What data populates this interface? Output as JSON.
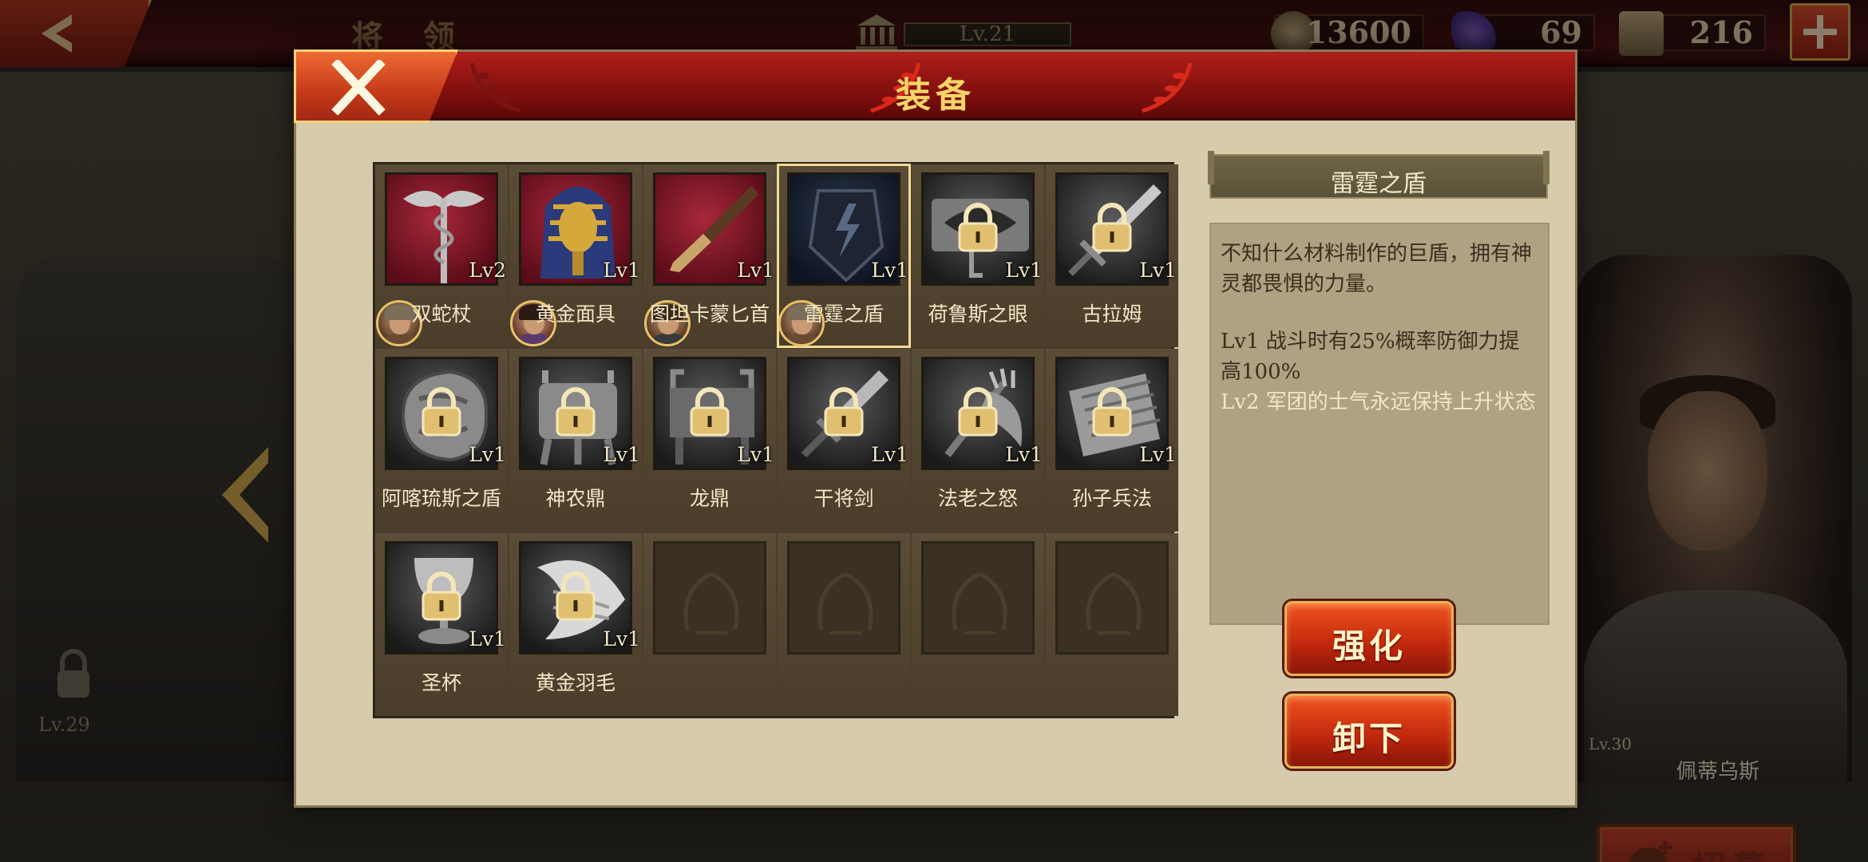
{
  "topbar": {
    "screen_title": "将 领",
    "hall_level": "Lv.21",
    "resources": [
      {
        "icon": "coin-icon",
        "value": "13600"
      },
      {
        "icon": "gem-icon",
        "value": "69"
      },
      {
        "icon": "banner-icon",
        "value": "216"
      }
    ]
  },
  "background": {
    "locked_slot_level": "Lv.29",
    "hero_name": "佩蒂乌斯",
    "hero_level": "Lv.30",
    "recruit_label": "招募"
  },
  "modal": {
    "title": "装备",
    "items": [
      {
        "name": "双蛇杖",
        "level": "Lv2",
        "owned": true,
        "locked": false,
        "art": "caduceus"
      },
      {
        "name": "黄金面具",
        "level": "Lv1",
        "owned": true,
        "locked": false,
        "art": "golden-mask"
      },
      {
        "name": "图坦卡蒙匕首",
        "level": "Lv1",
        "owned": true,
        "locked": false,
        "art": "dagger"
      },
      {
        "name": "雷霆之盾",
        "level": "Lv1",
        "owned": true,
        "locked": false,
        "art": "thunder-shield",
        "selected": true
      },
      {
        "name": "荷鲁斯之眼",
        "level": "Lv1",
        "owned": false,
        "locked": true,
        "art": "eye-of-horus"
      },
      {
        "name": "古拉姆",
        "level": "Lv1",
        "owned": false,
        "locked": true,
        "art": "sword"
      },
      {
        "name": "阿喀琉斯之盾",
        "level": "Lv1",
        "owned": false,
        "locked": true,
        "art": "round-shield"
      },
      {
        "name": "神农鼎",
        "level": "Lv1",
        "owned": false,
        "locked": true,
        "art": "cauldron"
      },
      {
        "name": "龙鼎",
        "level": "Lv1",
        "owned": false,
        "locked": true,
        "art": "dragon-cauldron"
      },
      {
        "name": "干将剑",
        "level": "Lv1",
        "owned": false,
        "locked": true,
        "art": "short-sword"
      },
      {
        "name": "法老之怒",
        "level": "Lv1",
        "owned": false,
        "locked": true,
        "art": "axe"
      },
      {
        "name": "孙子兵法",
        "level": "Lv1",
        "owned": false,
        "locked": true,
        "art": "scroll"
      },
      {
        "name": "圣杯",
        "level": "Lv1",
        "owned": false,
        "locked": true,
        "art": "grail"
      },
      {
        "name": "黄金羽毛",
        "level": "Lv1",
        "owned": false,
        "locked": true,
        "art": "feather"
      }
    ],
    "empty_slots": 4,
    "detail": {
      "title": "雷霆之盾",
      "description": "不知什么材料制作的巨盾，拥有神灵都畏惧的力量。",
      "effects": [
        "Lv1  战斗时有25%概率防御力提高100%",
        "Lv2  军团的士气永远保持上升状态"
      ]
    },
    "buttons": {
      "upgrade": "强化",
      "unequip": "卸下"
    }
  }
}
